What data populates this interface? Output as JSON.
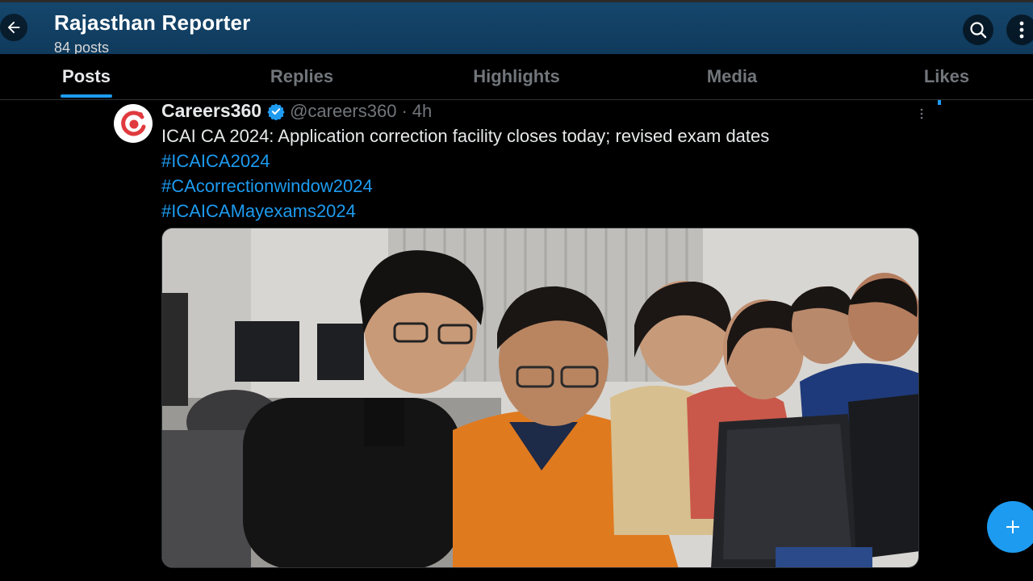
{
  "header": {
    "title": "Rajasthan Reporter",
    "post_count": "84 posts"
  },
  "tabs": [
    {
      "label": "Posts",
      "active": true
    },
    {
      "label": "Replies",
      "active": false
    },
    {
      "label": "Highlights",
      "active": false
    },
    {
      "label": "Media",
      "active": false
    },
    {
      "label": "Likes",
      "active": false
    }
  ],
  "post": {
    "author": "Careers360",
    "handle": "@careers360",
    "separator": "·",
    "time": "4h",
    "text": "ICAI CA 2024: Application correction facility closes today; revised exam dates",
    "hashtags": [
      "#ICAICA2024",
      "#CAcorrectionwindow2024",
      "#ICAICAMayexams2024"
    ],
    "media_description_icon": "photo-students-at-computers"
  },
  "colors": {
    "accent": "#1d9bf0",
    "header_bg": "#15466c",
    "muted_text": "#71767b",
    "background": "#000000"
  },
  "icons": {
    "back": "arrow-left-icon",
    "search": "search-icon",
    "more": "more-vertical-icon",
    "verified": "verified-badge-icon",
    "compose": "plus-icon"
  }
}
